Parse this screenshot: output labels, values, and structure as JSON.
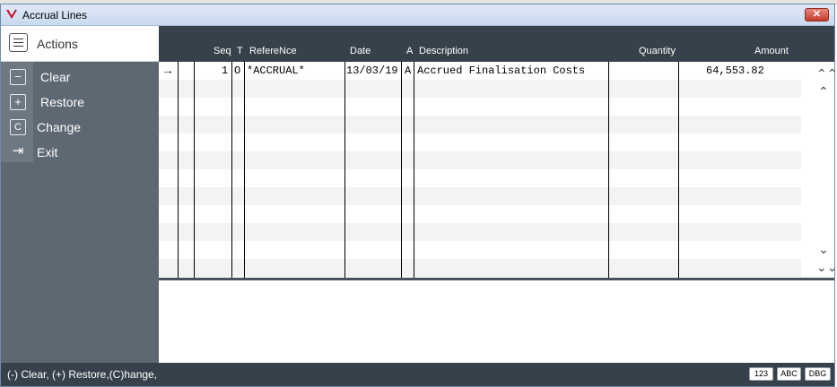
{
  "window": {
    "title": "Accrual Lines",
    "close_label": "✕"
  },
  "sidebar": {
    "header": "Actions",
    "items": [
      {
        "label": "Clear",
        "icon": "minus-box-icon",
        "glyph": "−"
      },
      {
        "label": "Restore",
        "icon": "plus-box-icon",
        "glyph": "+"
      },
      {
        "label": "Change",
        "icon": "c-box-icon",
        "glyph": "C"
      },
      {
        "label": "Exit",
        "icon": "exit-arrow-icon",
        "glyph": "⇥"
      }
    ]
  },
  "grid": {
    "columns": [
      "Seq",
      "T",
      "RefereNce",
      "Date",
      "A",
      "Description",
      "Quantity",
      "Amount"
    ],
    "rows": [
      {
        "pointer": "→",
        "seq": "1",
        "t": "O",
        "reference": "*ACCRUAL*",
        "date": "13/03/19",
        "a": "A",
        "description": "Accrued Finalisation Costs",
        "quantity": "",
        "amount": "64,553.82"
      }
    ],
    "scroll": {
      "top": "⌃⌃",
      "up": "⌃",
      "down": "⌄",
      "bottom": "⌄⌄"
    }
  },
  "status": {
    "text": "(-) Clear, (+) Restore,(C)hange,",
    "badges": [
      "123",
      "ABC",
      "DBG"
    ]
  },
  "colors": {
    "header_bg": "#37414b",
    "sidebar_bg": "#5e6873",
    "close_red": "#c53d2c"
  }
}
